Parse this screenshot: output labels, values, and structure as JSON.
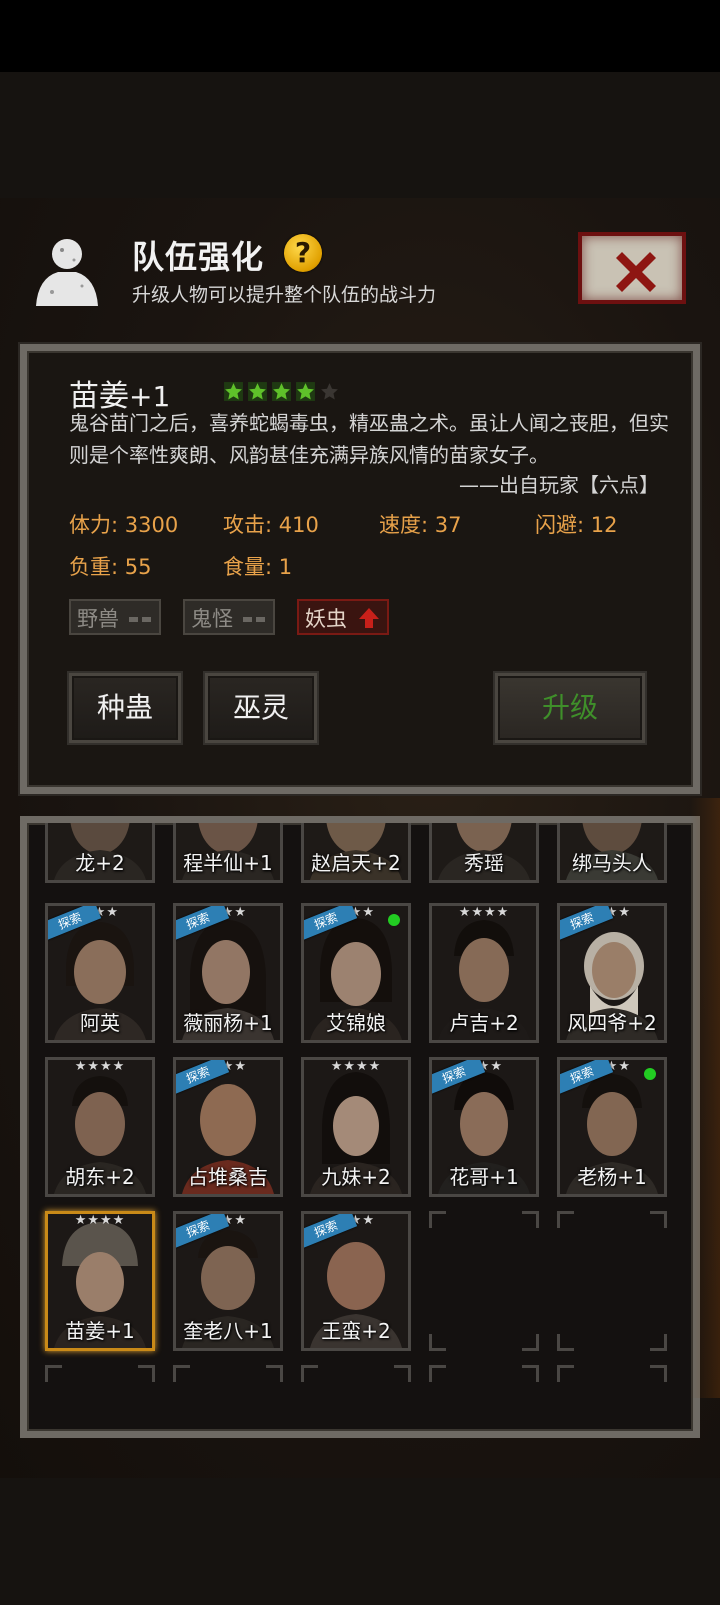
{
  "header": {
    "title": "队伍强化",
    "help_symbol": "?",
    "subtitle": "升级人物可以提升整个队伍的战斗力",
    "avatar_icon": "person-silhouette-icon",
    "close_icon": "close-x-icon"
  },
  "detail": {
    "name": "苗姜",
    "level_suffix": "+1",
    "stars": 4,
    "max_stars": 5,
    "description": "鬼谷苗门之后，喜养蛇蝎毒虫，精巫蛊之术。虽让人闻之丧胆，但实则是个率性爽朗、风韵甚佳充满异族风情的苗家女子。",
    "quote": "——出自玩家【六点】",
    "stats": [
      {
        "label": "体力:",
        "value": "3300"
      },
      {
        "label": "攻击:",
        "value": "410"
      },
      {
        "label": "速度:",
        "value": "37"
      },
      {
        "label": "闪避:",
        "value": "12"
      },
      {
        "label": "负重:",
        "value": "55"
      },
      {
        "label": "食量:",
        "value": "1"
      }
    ],
    "tags": [
      {
        "label": "野兽",
        "state": "neutral"
      },
      {
        "label": "鬼怪",
        "state": "neutral"
      },
      {
        "label": "妖虫",
        "state": "up"
      }
    ],
    "buttons": {
      "skill1": "种蛊",
      "skill2": "巫灵",
      "upgrade": "升级"
    }
  },
  "roster": {
    "row0": [
      {
        "name": "龙+2"
      },
      {
        "name": "程半仙+1"
      },
      {
        "name": "赵启天+2"
      },
      {
        "name": "秀瑶"
      },
      {
        "name": "绑马头人"
      }
    ],
    "row1": [
      {
        "name": "阿英",
        "stars": "★★★",
        "explore": true
      },
      {
        "name": "薇丽杨+1",
        "stars": "★★★",
        "explore": true
      },
      {
        "name": "艾锦娘",
        "stars": "★★★",
        "explore": true,
        "online": true
      },
      {
        "name": "卢吉+2",
        "stars": "★★★★"
      },
      {
        "name": "风四爷+2",
        "stars": "★★★",
        "explore": true
      }
    ],
    "row2": [
      {
        "name": "胡东+2",
        "stars": "★★★★"
      },
      {
        "name": "占堆桑吉",
        "stars": "★★★",
        "explore": true
      },
      {
        "name": "九妹+2",
        "stars": "★★★★"
      },
      {
        "name": "花哥+1",
        "stars": "★★★",
        "explore": true
      },
      {
        "name": "老杨+1",
        "stars": "★★★",
        "explore": true,
        "online": true
      }
    ],
    "row3": [
      {
        "name": "苗姜+1",
        "stars": "★★★★",
        "selected": true
      },
      {
        "name": "奎老八+1",
        "stars": "★★★",
        "explore": true
      },
      {
        "name": "王蛮+2",
        "stars": "★★★",
        "explore": true
      }
    ],
    "explore_label": "探索"
  },
  "colors": {
    "stat_orange": "#e8a24a",
    "star_green": "#5fc12a",
    "upgrade_green": "#3f8f2a",
    "explore_blue": "#2d7fb4",
    "selected_gold": "#c98a18"
  }
}
